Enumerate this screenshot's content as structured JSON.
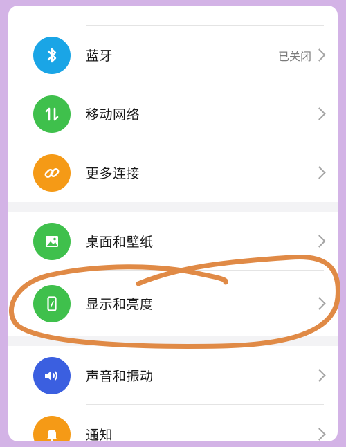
{
  "settings": {
    "items": [
      {
        "label": "蓝牙",
        "value": "已关闭",
        "icon": "bluetooth-icon",
        "color": "#1aa5e6"
      },
      {
        "label": "移动网络",
        "value": "",
        "icon": "mobile-network-icon",
        "color": "#3fc04c"
      },
      {
        "label": "更多连接",
        "value": "",
        "icon": "link-icon",
        "color": "#f59a16"
      },
      {
        "label": "桌面和壁纸",
        "value": "",
        "icon": "wallpaper-icon",
        "color": "#3fc04c"
      },
      {
        "label": "显示和亮度",
        "value": "",
        "icon": "display-icon",
        "color": "#3fc04c"
      },
      {
        "label": "声音和振动",
        "value": "",
        "icon": "sound-icon",
        "color": "#3b5fe0"
      },
      {
        "label": "通知",
        "value": "",
        "icon": "bell-icon",
        "color": "#f59a16"
      }
    ]
  },
  "annotation": {
    "color": "#e08a46",
    "target": "显示和亮度"
  }
}
